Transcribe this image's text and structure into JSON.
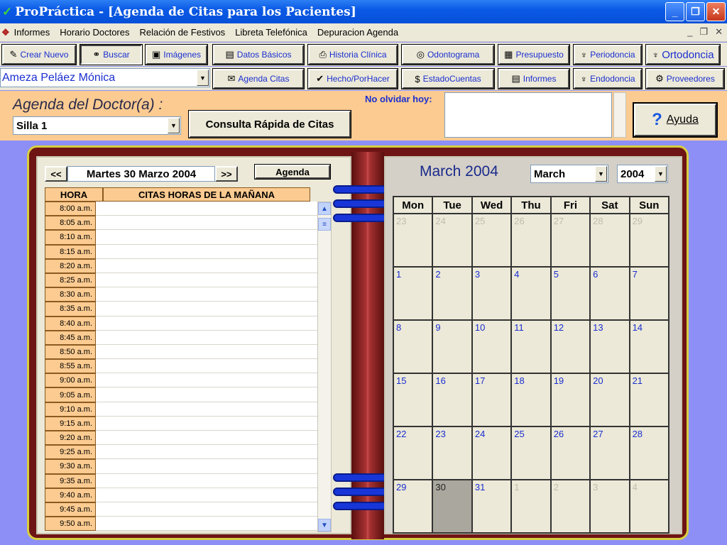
{
  "window": {
    "title": "ProPráctica - [Agenda de Citas para los Pacientes]"
  },
  "menu": {
    "items": [
      "Informes",
      "Horario Doctores",
      "Relación de Festivos",
      "Libreta Telefónica",
      "Depuracion Agenda"
    ]
  },
  "toolbar1": [
    {
      "label": "Crear Nuevo",
      "icon": "pencil-icon"
    },
    {
      "label": "Buscar",
      "icon": "binoculars-icon"
    },
    {
      "label": "Imágenes",
      "icon": "camera-icon"
    },
    {
      "label": "Datos Básicos",
      "icon": "card-icon"
    },
    {
      "label": "Historia Clínica",
      "icon": "printer-icon"
    },
    {
      "label": "Odontograma",
      "icon": "odontogram-icon"
    },
    {
      "label": "Presupuesto",
      "icon": "budget-icon"
    },
    {
      "label": "Periodoncia",
      "icon": "tooth-icon"
    },
    {
      "label": "Ortodoncia",
      "icon": "braces-icon"
    }
  ],
  "toolbar2": {
    "doctor": "Ameza Peláez Mónica",
    "buttons": [
      {
        "label": "Agenda Citas",
        "icon": "agenda-icon"
      },
      {
        "label": "Hecho/PorHacer",
        "icon": "check-icon"
      },
      {
        "label": "EstadoCuentas",
        "icon": "money-icon"
      },
      {
        "label": "Informes",
        "icon": "document-icon"
      },
      {
        "label": "Endodoncia",
        "icon": "tooth-icon"
      },
      {
        "label": "Proveedores",
        "icon": "supplier-icon"
      }
    ]
  },
  "header": {
    "agenda_label": "Agenda del Doctor(a) :",
    "silla": "Silla 1",
    "consulta": "Consulta Rápida de Citas",
    "no_olvidar_label": "No olvidar hoy:",
    "ayuda": "Ayuda"
  },
  "agenda": {
    "date": "Martes 30 Marzo 2004",
    "prev": "<<",
    "next": ">>",
    "agenda_btn": "Agenda",
    "col_hora": "HORA",
    "col_citas": "CITAS HORAS DE LA MAÑANA",
    "times": [
      "8:00 a.m.",
      "8:05 a.m.",
      "8:10 a.m.",
      "8:15 a.m.",
      "8:20 a.m.",
      "8:25 a.m.",
      "8:30 a.m.",
      "8:35 a.m.",
      "8:40 a.m.",
      "8:45 a.m.",
      "8:50 a.m.",
      "8:55 a.m.",
      "9:00 a.m.",
      "9:05 a.m.",
      "9:10 a.m.",
      "9:15 a.m.",
      "9:20 a.m.",
      "9:25 a.m.",
      "9:30 a.m.",
      "9:35 a.m.",
      "9:40 a.m.",
      "9:45 a.m.",
      "9:50 a.m."
    ]
  },
  "calendar": {
    "title": "March 2004",
    "month": "March",
    "year": "2004",
    "days": [
      "Mon",
      "Tue",
      "Wed",
      "Thu",
      "Fri",
      "Sat",
      "Sun"
    ],
    "cells": [
      {
        "d": "23",
        "o": true
      },
      {
        "d": "24",
        "o": true
      },
      {
        "d": "25",
        "o": true
      },
      {
        "d": "26",
        "o": true
      },
      {
        "d": "27",
        "o": true
      },
      {
        "d": "28",
        "o": true
      },
      {
        "d": "29",
        "o": true
      },
      {
        "d": "1"
      },
      {
        "d": "2"
      },
      {
        "d": "3"
      },
      {
        "d": "4"
      },
      {
        "d": "5"
      },
      {
        "d": "6"
      },
      {
        "d": "7"
      },
      {
        "d": "8"
      },
      {
        "d": "9"
      },
      {
        "d": "10"
      },
      {
        "d": "11"
      },
      {
        "d": "12"
      },
      {
        "d": "13"
      },
      {
        "d": "14"
      },
      {
        "d": "15"
      },
      {
        "d": "16"
      },
      {
        "d": "17"
      },
      {
        "d": "18"
      },
      {
        "d": "19"
      },
      {
        "d": "20"
      },
      {
        "d": "21"
      },
      {
        "d": "22"
      },
      {
        "d": "23"
      },
      {
        "d": "24"
      },
      {
        "d": "25"
      },
      {
        "d": "26"
      },
      {
        "d": "27"
      },
      {
        "d": "28"
      },
      {
        "d": "29"
      },
      {
        "d": "30",
        "s": true
      },
      {
        "d": "31"
      },
      {
        "d": "1",
        "o": true
      },
      {
        "d": "2",
        "o": true
      },
      {
        "d": "3",
        "o": true
      },
      {
        "d": "4",
        "o": true
      }
    ]
  }
}
